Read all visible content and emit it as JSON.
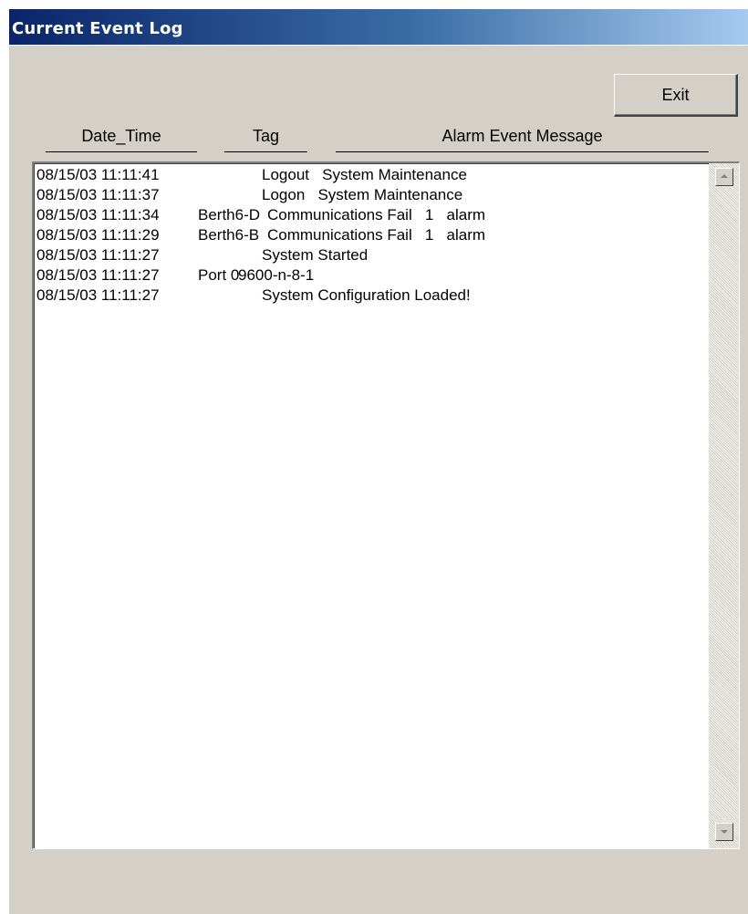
{
  "window": {
    "title": "Current Event Log"
  },
  "buttons": {
    "exit_label": "Exit"
  },
  "columns": {
    "date_time": "Date_Time",
    "tag": "Tag",
    "message": "Alarm Event Message"
  },
  "log": {
    "rows": [
      {
        "date_time": "08/15/03 11:11:41",
        "tag": "",
        "message": "Logout   System Maintenance"
      },
      {
        "date_time": "08/15/03 11:11:37",
        "tag": "",
        "message": "Logon   System Maintenance"
      },
      {
        "date_time": "08/15/03 11:11:34",
        "tag": "Berth6-D",
        "message": "Communications Fail   1   alarm"
      },
      {
        "date_time": "08/15/03 11:11:29",
        "tag": "Berth6-B",
        "message": "Communications Fail   1   alarm"
      },
      {
        "date_time": "08/15/03 11:11:27",
        "tag": "",
        "message": "System Started"
      },
      {
        "date_time": "08/15/03 11:11:27",
        "tag": "Port 0",
        "message": "9600-n-8-1"
      },
      {
        "date_time": "08/15/03 11:11:27",
        "tag": "",
        "message": "System Configuration Loaded!"
      }
    ]
  },
  "colors": {
    "window_bg": "#d4d0c8",
    "title_gradient_start": "#0a246a",
    "title_gradient_end": "#a6caf0",
    "list_bg": "#ffffff"
  },
  "icons": {
    "scroll_up": "scroll-up-arrow-icon",
    "scroll_down": "scroll-down-arrow-icon"
  }
}
